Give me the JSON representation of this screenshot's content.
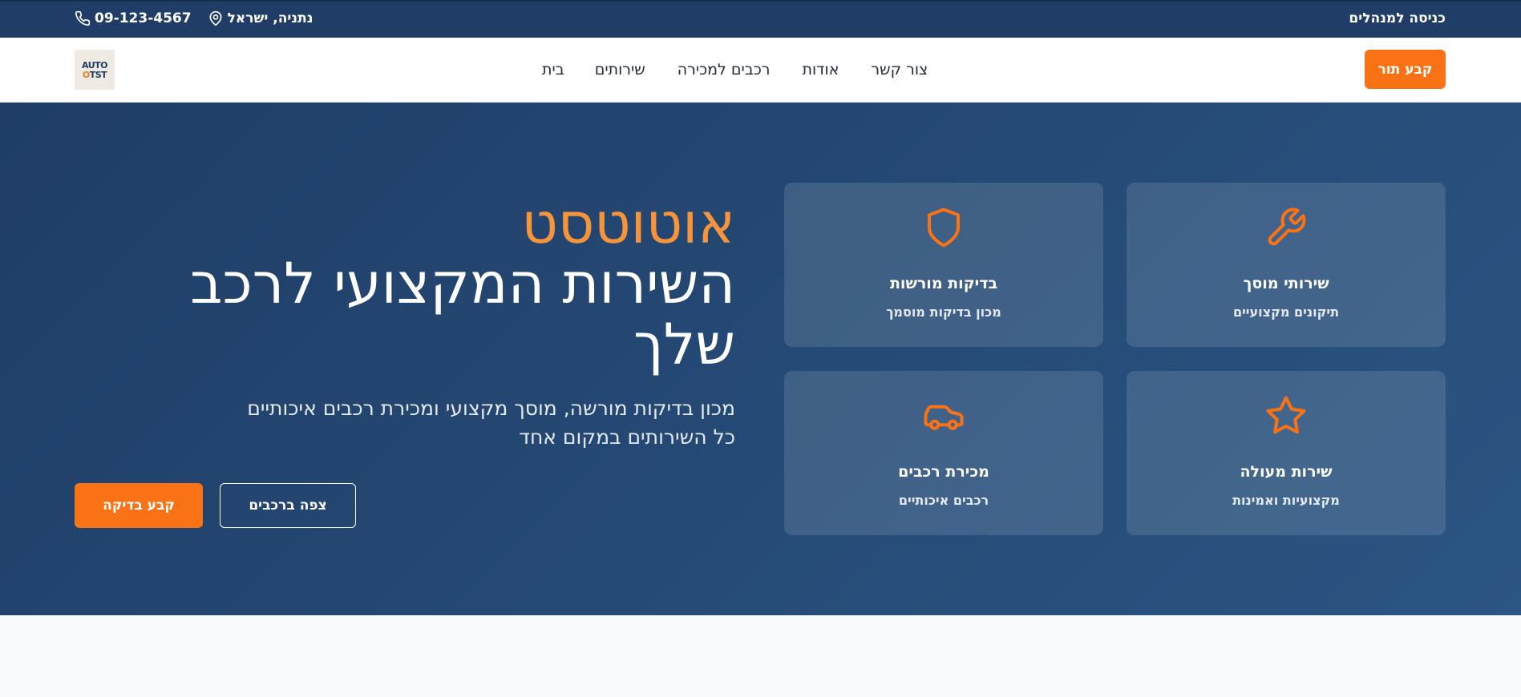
{
  "topbar": {
    "admin_login": "כניסה למנהלים",
    "location": "נתניה, ישראל",
    "phone": "09-123-4567"
  },
  "navbar": {
    "logo_line1": "AUTO",
    "logo_line2_o": "O",
    "logo_line2_rest": "TST",
    "links": [
      "בית",
      "שירותים",
      "רכבים למכירה",
      "אודות",
      "צור קשר"
    ],
    "book_button": "קבע תור"
  },
  "hero": {
    "brand": "אוטוטסט",
    "headline": "השירות המקצועי לרכב שלך",
    "sub_line1": "מכון בדיקות מורשה, מוסך מקצועי ומכירת רכבים איכותיים",
    "sub_line2": "כל השירותים במקום אחד",
    "btn_check": "קבע בדיקה",
    "btn_cars": "צפה ברכבים"
  },
  "cards": [
    {
      "icon": "wrench-icon",
      "title": "שירותי מוסך",
      "subtitle": "תיקונים מקצועיים"
    },
    {
      "icon": "shield-icon",
      "title": "בדיקות מורשות",
      "subtitle": "מכון בדיקות מוסמך"
    },
    {
      "icon": "star-icon",
      "title": "שירות מעולה",
      "subtitle": "מקצועיות ואמינות"
    },
    {
      "icon": "car-icon",
      "title": "מכירת רכבים",
      "subtitle": "רכבים איכותיים"
    }
  ],
  "colors": {
    "accent": "#f97316",
    "brand_text": "#f5943a",
    "navy": "#1f3d66"
  }
}
